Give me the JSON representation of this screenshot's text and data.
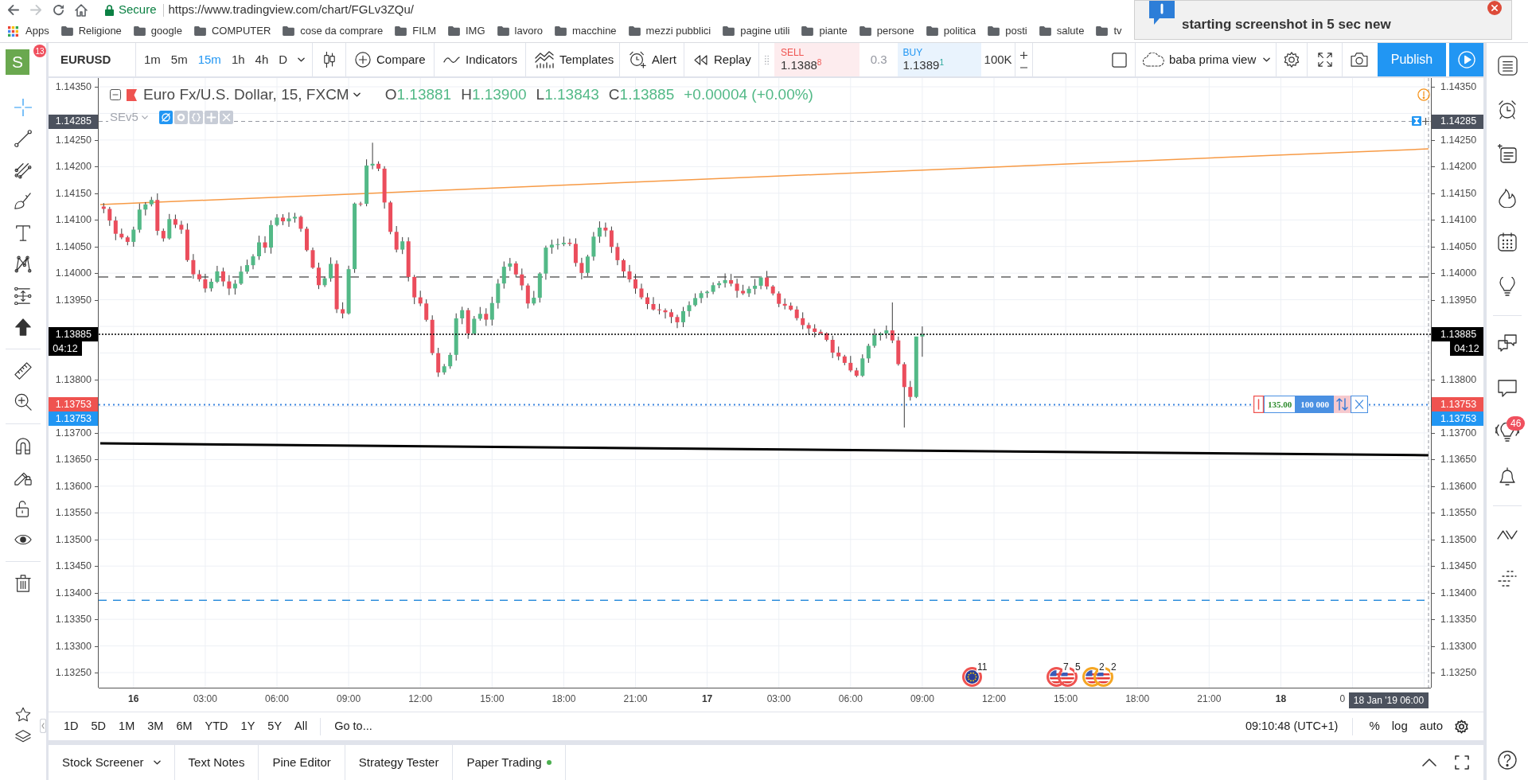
{
  "browser": {
    "forward_disabled": true,
    "secure_label": "Secure",
    "url": "https://www.tradingview.com/chart/FGLv3ZQu/"
  },
  "bookmarks": {
    "apps": "Apps",
    "folders": [
      "Religione",
      "google",
      "COMPUTER",
      "cose da comprare",
      "FILM",
      "IMG",
      "lavoro",
      "macchine",
      "mezzi pubblici",
      "pagine utili",
      "piante",
      "persone",
      "politica",
      "posti",
      "salute",
      "tv"
    ]
  },
  "notification": {
    "message": "starting screenshot in 5 sec new"
  },
  "user": {
    "initial": "S",
    "badge": "13"
  },
  "toolbar": {
    "symbol": "EURUSD",
    "intervals": [
      {
        "label": "1m",
        "selected": false
      },
      {
        "label": "5m",
        "selected": false
      },
      {
        "label": "15m",
        "selected": true
      },
      {
        "label": "1h",
        "selected": false
      },
      {
        "label": "4h",
        "selected": false
      },
      {
        "label": "D",
        "selected": false
      }
    ],
    "actions": [
      "Compare",
      "Indicators",
      "Templates",
      "Alert",
      "Replay"
    ],
    "trade": {
      "sell_label": "SELL",
      "sell_price": "1.1388$^{8}$",
      "spread": "0.3",
      "buy_label": "BUY",
      "buy_price": "1.1389$^{1}$",
      "quantity": "100K"
    },
    "layout": "baba prima view",
    "publish": "Publish"
  },
  "left_toolbar": {
    "tools": [
      {
        "selected": true
      },
      {
        "selected": false
      },
      {
        "selected": false
      },
      {
        "selected": false
      },
      {
        "selected": false
      },
      {
        "selected": false
      },
      {
        "selected": false
      },
      {
        "selected": false
      },
      {
        "selected": false
      },
      {
        "selected": false
      },
      {
        "selected": false
      },
      {
        "selected": false
      },
      {
        "selected": false
      },
      {
        "selected": false
      },
      {
        "selected": false
      }
    ]
  },
  "legend": {
    "title": "Euro Fx/U.S. Dollar, 15, FXCM",
    "ohlc": [
      {
        "key": "O",
        "value": "1.13881"
      },
      {
        "key": "H",
        "value": "1.13900"
      },
      {
        "key": "L",
        "value": "1.13843"
      },
      {
        "key": "C",
        "value": "1.13885"
      }
    ],
    "change": "+0.00004 (+0.00%)",
    "study": "SEv5"
  },
  "price_axis_left": {
    "ticks": [
      "1.14350",
      "1.14250",
      "1.14200",
      "1.14150",
      "1.14100",
      "1.14050",
      "1.14000",
      "1.13950",
      "1.13800",
      "1.13700",
      "1.13650",
      "1.13600",
      "1.13550",
      "1.13500",
      "1.13450",
      "1.13400",
      "1.13350",
      "1.13300",
      "1.13250"
    ],
    "tags": [
      {
        "kind": "alert",
        "label": "1.14285"
      },
      {
        "kind": "last",
        "label": "1.13885"
      },
      {
        "kind": "countdown",
        "label": "04:12"
      },
      {
        "kind": "order",
        "label": "1.13753"
      },
      {
        "kind": "line",
        "label": "1.13753"
      }
    ]
  },
  "price_axis_right": {
    "ticks": [
      "1.14350",
      "1.14250",
      "1.14200",
      "1.14150",
      "1.14100",
      "1.14050",
      "1.14000",
      "1.13950",
      "1.13800",
      "1.13700",
      "1.13650",
      "1.13600",
      "1.13550",
      "1.13500",
      "1.13450",
      "1.13400",
      "1.13350",
      "1.13300",
      "1.13250"
    ],
    "tags": [
      {
        "kind": "alert",
        "label": "1.14285"
      },
      {
        "kind": "last",
        "label": "1.13885"
      },
      {
        "kind": "countdown",
        "label": "04:12"
      },
      {
        "kind": "order",
        "label": "1.13753"
      },
      {
        "kind": "line",
        "label": "1.13753"
      }
    ]
  },
  "order": {
    "price": "135.00",
    "quantity": "100 000"
  },
  "events": [
    {
      "kind": "eu",
      "count": "11",
      "color": "#ef5350"
    },
    {
      "kind": "us",
      "count": "7",
      "color": "#ef5350"
    },
    {
      "kind": "us",
      "count": "5",
      "color": "#ef5350"
    },
    {
      "kind": "us",
      "count": "2",
      "color": "#f5a623"
    },
    {
      "kind": "us",
      "count": "2",
      "color": "#f5a623"
    }
  ],
  "time_axis": {
    "labels": [
      {
        "kind": "day",
        "text": "16"
      },
      {
        "kind": "time",
        "text": "03:00"
      },
      {
        "kind": "time",
        "text": "06:00"
      },
      {
        "kind": "time",
        "text": "09:00"
      },
      {
        "kind": "time",
        "text": "12:00"
      },
      {
        "kind": "time",
        "text": "15:00"
      },
      {
        "kind": "time",
        "text": "18:00"
      },
      {
        "kind": "time",
        "text": "21:00"
      },
      {
        "kind": "day",
        "text": "17"
      },
      {
        "kind": "time",
        "text": "03:00"
      },
      {
        "kind": "time",
        "text": "06:00"
      },
      {
        "kind": "time",
        "text": "09:00"
      },
      {
        "kind": "time",
        "text": "12:00"
      },
      {
        "kind": "time",
        "text": "15:00"
      },
      {
        "kind": "time",
        "text": "18:00"
      },
      {
        "kind": "time",
        "text": "21:00"
      },
      {
        "kind": "day",
        "text": "18"
      },
      {
        "kind": "clipped",
        "text": "0"
      }
    ],
    "cursor_tag": "18 Jan '19 06:00"
  },
  "range_bar": {
    "ranges": [
      "1D",
      "5D",
      "1M",
      "3M",
      "6M",
      "YTD",
      "1Y",
      "5Y",
      "All"
    ],
    "goto": "Go to...",
    "clock": "09:10:48 (UTC+1)",
    "scales": [
      "%",
      "log",
      "auto"
    ]
  },
  "bottom_panel": {
    "tabs": [
      {
        "label": "Stock Screener",
        "kind": "dropdown"
      },
      {
        "label": "Text Notes",
        "kind": "plain"
      },
      {
        "label": "Pine Editor",
        "kind": "plain"
      },
      {
        "label": "Strategy Tester",
        "kind": "plain"
      },
      {
        "label": "Paper Trading",
        "kind": "status"
      }
    ]
  },
  "right_sidebar": {
    "ideas_badge": "46"
  }
}
